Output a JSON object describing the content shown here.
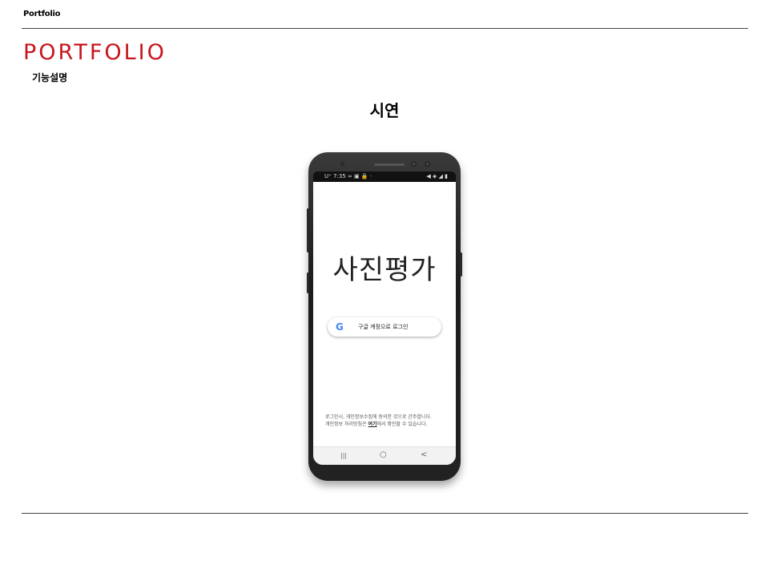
{
  "header": {
    "label": "Portfolio",
    "title": "PORTFOLIO",
    "subtitle": "기능설명"
  },
  "section": {
    "title": "시연"
  },
  "phone": {
    "status_left": "U⁺ 7:35 ∞ ▣ 🔒 ·",
    "status_right": "◀ ◈ ◢ ▮",
    "app_title": "사진평가",
    "google_button": {
      "icon": "G",
      "label": "구글 계정으로 로그인"
    },
    "notice": {
      "line1": "로그인시, 개인정보수집에 동의한 것으로 간주합니다.",
      "line2_prefix": "개인정보 처리방침은 ",
      "line2_link": "여기",
      "line2_suffix": "에서 확인할 수 있습니다."
    },
    "nav": {
      "recents": "|||",
      "home": "○",
      "back": "<"
    }
  },
  "colors": {
    "title_red": "#c8151d",
    "google_blue": "#4285F4"
  }
}
